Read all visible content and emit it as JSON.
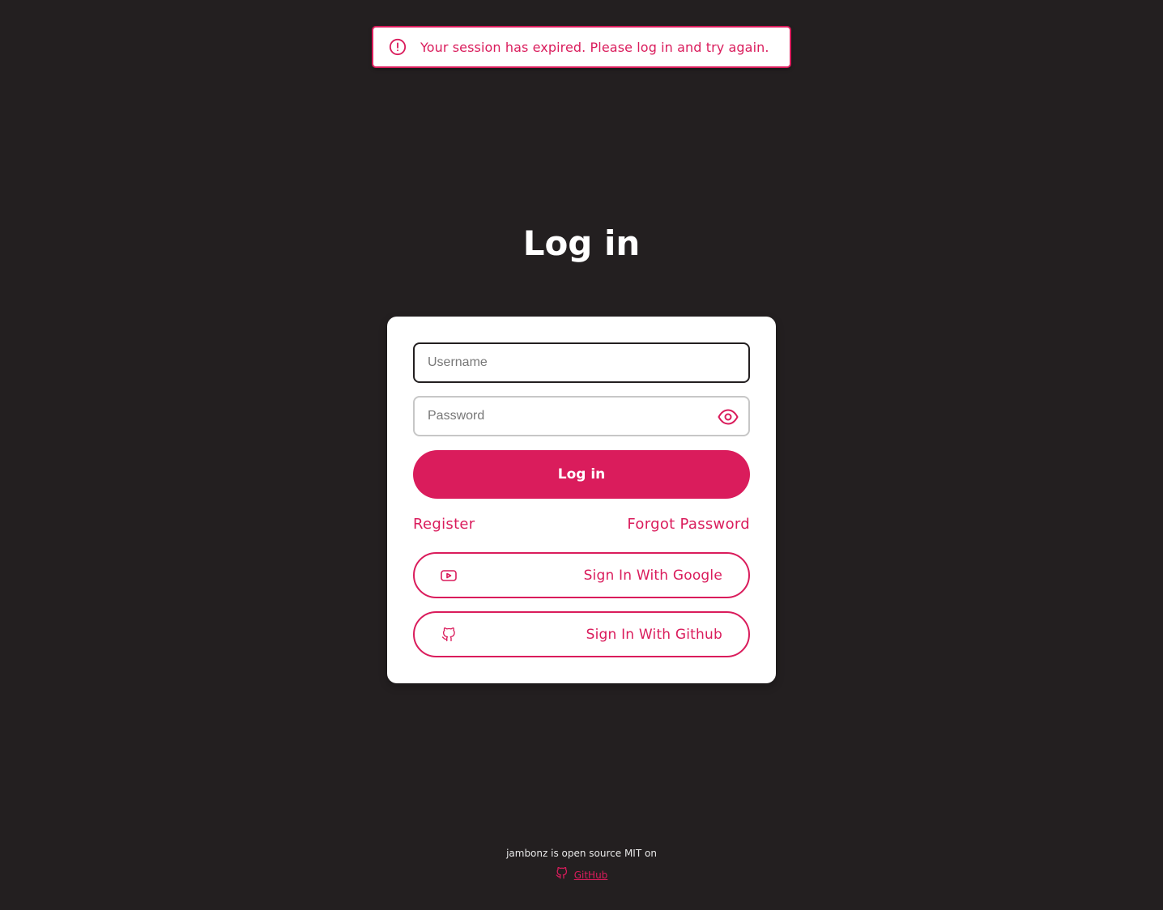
{
  "toast": {
    "message": "Your session has expired. Please log in and try again.",
    "icon": "alert-circle-icon",
    "color": "#da1c5c"
  },
  "page": {
    "title": "Log in"
  },
  "form": {
    "username_placeholder": "Username",
    "username_value": "",
    "password_placeholder": "Password",
    "password_value": "",
    "show_password_icon": "eye-icon",
    "login_label": "Log in",
    "register_label": "Register",
    "forgot_label": "Forgot Password"
  },
  "social": {
    "google_label": "Sign In With Google",
    "google_icon": "youtube-icon",
    "github_label": "Sign In With Github",
    "github_icon": "github-icon"
  },
  "footer": {
    "text": "jambonz is open source MIT on",
    "link_label": "GitHub",
    "link_icon": "github-icon"
  },
  "colors": {
    "background": "#231f20",
    "accent": "#da1c5c",
    "card": "#ffffff"
  }
}
